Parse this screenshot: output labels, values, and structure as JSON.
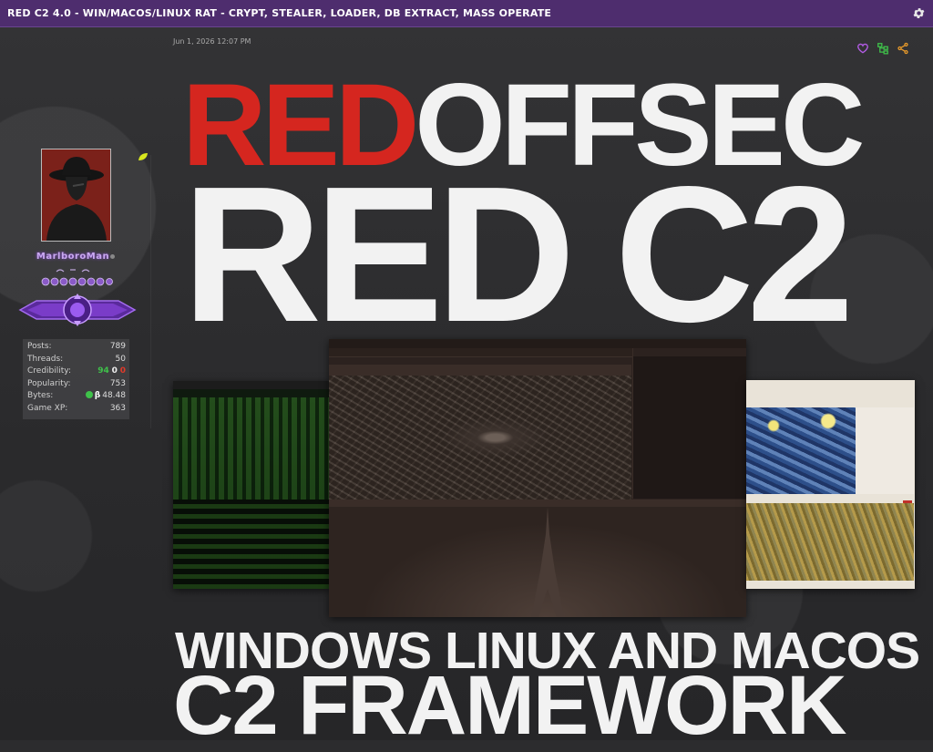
{
  "thread": {
    "title": "RED C2 4.0 - WIN/MACOS/LINUX RAT - CRYPT, STEALER, LOADER, DB EXTRACT, MASS OPERATE",
    "date": "Jun 1, 2026 12:07 PM"
  },
  "user": {
    "username": "MarlboroMan",
    "stats": [
      {
        "label": "Posts:",
        "value": "789"
      },
      {
        "label": "Threads:",
        "value": "50"
      },
      {
        "label": "Credibility:",
        "pos": "94",
        "neu": "0",
        "neg": "0"
      },
      {
        "label": "Popularity:",
        "value": "753"
      },
      {
        "label": "Bytes:",
        "value": "48.48",
        "currency": "β"
      },
      {
        "label": "Game XP:",
        "value": "363"
      }
    ]
  },
  "banner": {
    "line1_red": "RED",
    "line1_white": "OFFSEC",
    "line2": "RED C2",
    "line3": "WINDOWS LINUX AND MACOS",
    "line4": "C2 FRAMEWORK"
  },
  "icons": {
    "settings": "gear-icon",
    "like": "heart-icon",
    "thread_tree": "tree-icon",
    "share": "share-icon",
    "leaf": "leaf-icon",
    "online": "status-dot-icon"
  },
  "colors": {
    "titlebar": "#4e2d6e",
    "accent_red": "#d5261f",
    "credibility_positive": "#3fc24a",
    "credibility_negative": "#e03a2a",
    "like": "#b45ce6",
    "tree": "#3fc24a",
    "share": "#e89a2a"
  }
}
